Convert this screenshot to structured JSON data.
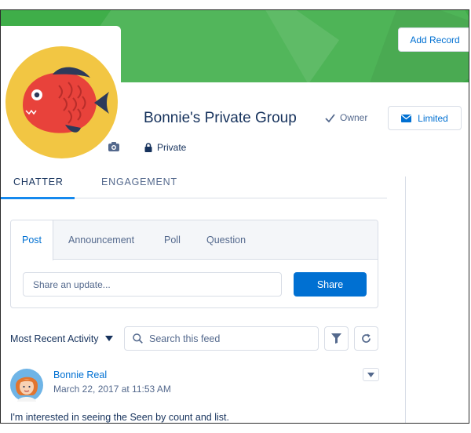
{
  "header": {
    "add_record_label": "Add Record",
    "group_name": "Bonnie's Private Group",
    "owner_label": "Owner",
    "limited_label": "Limited",
    "privacy_label": "Private",
    "banner_color": "#3fae49",
    "avatar_bg": "#f2c643",
    "fish_color": "#e8423b"
  },
  "tabs": [
    {
      "label": "CHATTER",
      "active": true
    },
    {
      "label": "ENGAGEMENT",
      "active": false
    }
  ],
  "publisher": {
    "tabs": [
      "Post",
      "Announcement",
      "Poll",
      "Question"
    ],
    "active_tab": "Post",
    "input_placeholder": "Share an update...",
    "share_label": "Share"
  },
  "feed": {
    "sort_label": "Most Recent Activity",
    "search_placeholder": "Search this feed",
    "filter_icon": "filter-icon",
    "refresh_icon": "refresh-icon"
  },
  "post": {
    "author": "Bonnie Real",
    "timestamp": "March 22, 2017 at 11:53 AM",
    "body": "I'm interested in seeing the Seen by count and list."
  },
  "colors": {
    "brand_blue": "#0070d2",
    "text_dark": "#16325c",
    "text_muted": "#54698d",
    "border": "#d8dde6"
  }
}
